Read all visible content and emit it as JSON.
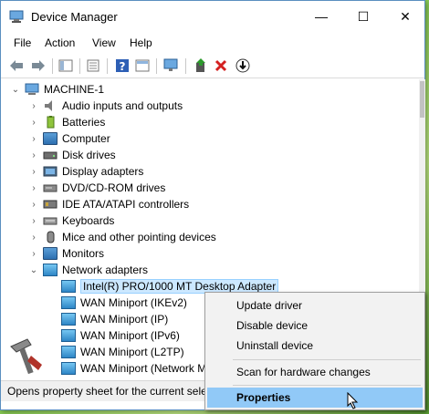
{
  "window": {
    "title": "Device Manager",
    "minimize": "—",
    "maximize": "☐",
    "close": "✕"
  },
  "menu": [
    "File",
    "Action",
    "View",
    "Help"
  ],
  "tree": {
    "root": "MACHINE-1",
    "categories": [
      "Audio inputs and outputs",
      "Batteries",
      "Computer",
      "Disk drives",
      "Display adapters",
      "DVD/CD-ROM drives",
      "IDE ATA/ATAPI controllers",
      "Keyboards",
      "Mice and other pointing devices",
      "Monitors",
      "Network adapters"
    ],
    "network_children": [
      "Intel(R) PRO/1000 MT Desktop Adapter",
      "WAN Miniport (IKEv2)",
      "WAN Miniport (IP)",
      "WAN Miniport (IPv6)",
      "WAN Miniport (L2TP)",
      "WAN Miniport (Network M"
    ]
  },
  "status": "Opens property sheet for the current sele",
  "context_menu": {
    "update": "Update driver",
    "disable": "Disable device",
    "uninstall": "Uninstall device",
    "scan": "Scan for hardware changes",
    "properties": "Properties"
  },
  "colors": {
    "selection": "#cce8ff",
    "menu_highlight": "#91c9f7",
    "window_border": "#5a8fbf"
  }
}
